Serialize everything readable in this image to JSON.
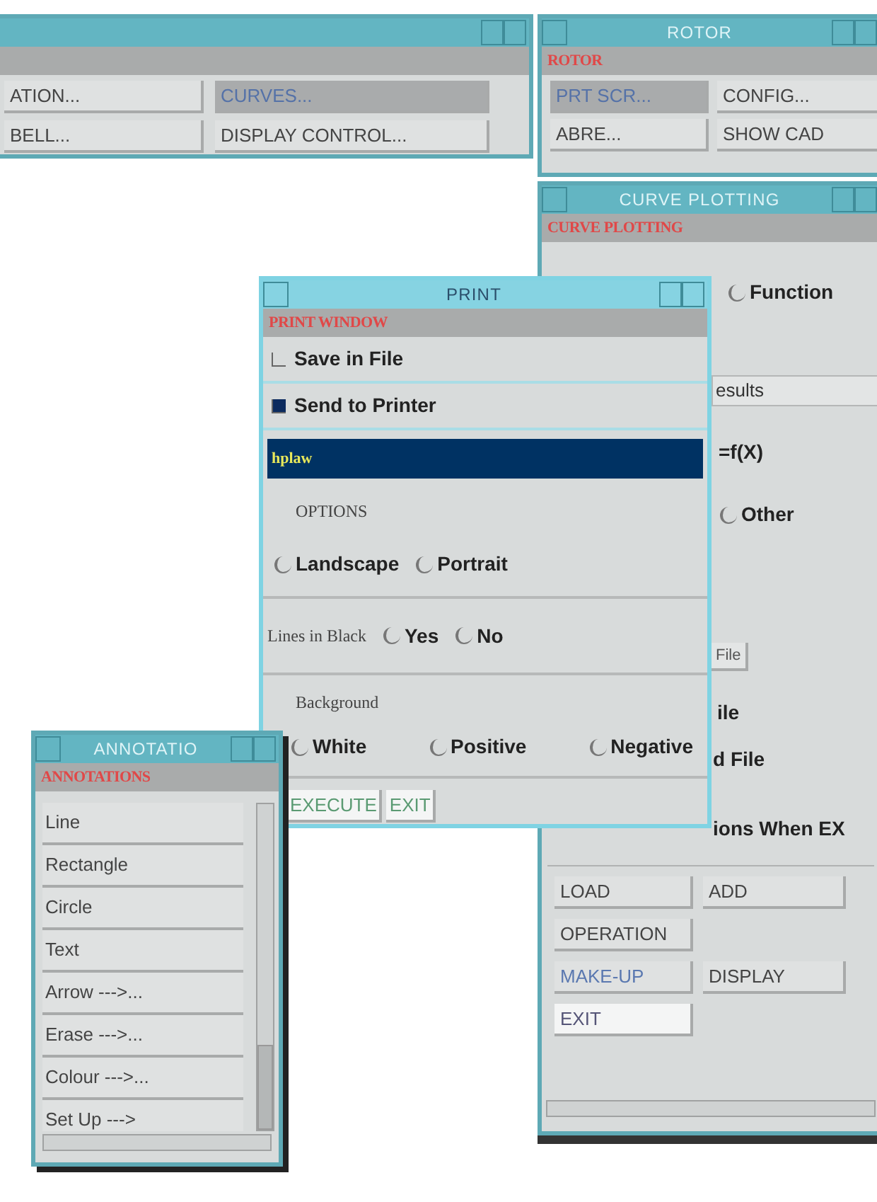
{
  "main_window": {
    "buttons": [
      {
        "label": "ATION...",
        "selected": false
      },
      {
        "label": "CURVES...",
        "selected": true
      },
      {
        "label": "BELL...",
        "selected": false
      },
      {
        "label": "DISPLAY CONTROL...",
        "selected": false
      }
    ]
  },
  "rotor_window": {
    "title": "ROTOR",
    "heading": "ROTOR",
    "buttons": [
      {
        "label": "PRT SCR...",
        "selected": true
      },
      {
        "label": "CONFIG...",
        "selected": false
      },
      {
        "label": "ABRE...",
        "selected": false
      },
      {
        "label": "SHOW CAD",
        "selected": false
      }
    ]
  },
  "curve_window": {
    "title": "CURVE PLOTTING",
    "heading": "CURVE PLOTTING",
    "fragments": [
      {
        "kind": "radio",
        "label": "Function",
        "selected": false
      },
      {
        "kind": "field",
        "value": "esults"
      },
      {
        "kind": "text",
        "label": "=f(X)"
      },
      {
        "kind": "radio",
        "label": "Other",
        "selected": false
      },
      {
        "kind": "button",
        "label": "File"
      },
      {
        "kind": "text",
        "label": "ile"
      },
      {
        "kind": "text",
        "label": "d File"
      },
      {
        "kind": "text",
        "label": "ions When EX"
      }
    ],
    "buttons": [
      {
        "label": "LOAD",
        "kind": "push"
      },
      {
        "label": "ADD",
        "kind": "push"
      },
      {
        "label": "OPERATION",
        "kind": "push"
      },
      {
        "label": "MAKE-UP",
        "kind": "accent"
      },
      {
        "label": "DISPLAY",
        "kind": "push"
      },
      {
        "label": "EXIT",
        "kind": "light"
      }
    ]
  },
  "print_window": {
    "title": "PRINT",
    "heading": "PRINT WINDOW",
    "checkboxes": [
      {
        "label": "Save in File",
        "checked": false
      },
      {
        "label": "Send to Printer",
        "checked": true
      }
    ],
    "printer": {
      "value": "hplaw"
    },
    "options_label": "OPTIONS",
    "orientation": [
      {
        "label": "Landscape",
        "selected": false
      },
      {
        "label": "Portrait",
        "selected": false
      }
    ],
    "lines_in_black": {
      "label": "Lines in Black",
      "options": [
        {
          "label": "Yes",
          "selected": false
        },
        {
          "label": "No",
          "selected": false
        }
      ]
    },
    "background": {
      "label": "Background",
      "options": [
        {
          "label": "White",
          "selected": false
        },
        {
          "label": "Positive",
          "selected": false
        },
        {
          "label": "Negative",
          "selected": false
        }
      ]
    },
    "buttons": [
      "EXECUTE",
      "EXIT"
    ]
  },
  "annotation_window": {
    "title": "ANNOTATIO",
    "heading": "ANNOTATIONS",
    "items": [
      "Line",
      "Rectangle",
      "Circle",
      "Text",
      "Arrow --->...",
      "Erase --->...",
      "Colour --->...",
      "Set Up --->"
    ]
  }
}
